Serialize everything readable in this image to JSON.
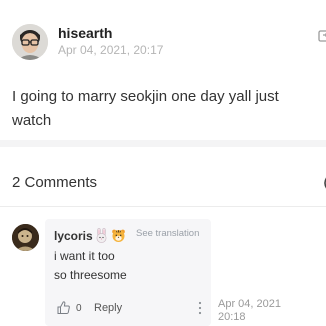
{
  "post": {
    "username": "hisearth",
    "date": "Apr 04, 2021, 20:17",
    "text": "I going to marry seokjin one day yall just watch"
  },
  "comments_section": {
    "title": "2 Comments"
  },
  "comment": {
    "username": "lycoris",
    "emojis": [
      "rabbit-emoji",
      "tiger-emoji"
    ],
    "see_translation": "See translation",
    "lines": [
      "i want it too",
      "so threesome"
    ],
    "like_count": "0",
    "reply_label": "Reply",
    "date_line1": "Apr 04, 2021",
    "date_line2": "20:18"
  },
  "colors": {
    "text_primary": "#333333",
    "text_muted": "#b5b5b5",
    "bubble": "#f6f6f8",
    "section_separator": "#f4f4f5"
  }
}
